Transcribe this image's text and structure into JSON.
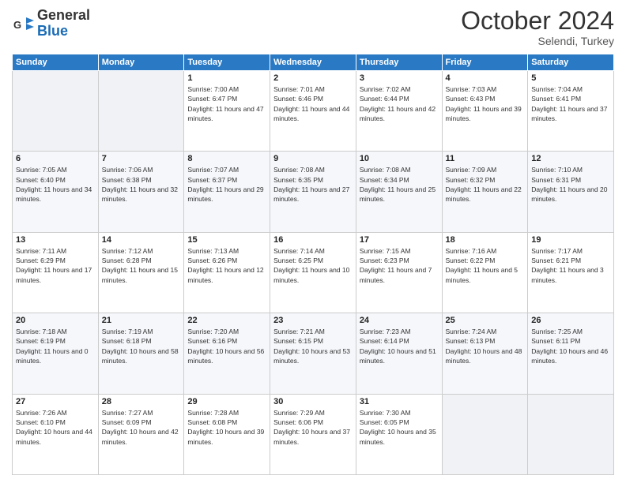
{
  "header": {
    "logo_line1": "General",
    "logo_line2": "Blue",
    "month_title": "October 2024",
    "subtitle": "Selendi, Turkey"
  },
  "weekdays": [
    "Sunday",
    "Monday",
    "Tuesday",
    "Wednesday",
    "Thursday",
    "Friday",
    "Saturday"
  ],
  "weeks": [
    [
      {
        "day": "",
        "info": ""
      },
      {
        "day": "",
        "info": ""
      },
      {
        "day": "1",
        "info": "Sunrise: 7:00 AM\nSunset: 6:47 PM\nDaylight: 11 hours and 47 minutes."
      },
      {
        "day": "2",
        "info": "Sunrise: 7:01 AM\nSunset: 6:46 PM\nDaylight: 11 hours and 44 minutes."
      },
      {
        "day": "3",
        "info": "Sunrise: 7:02 AM\nSunset: 6:44 PM\nDaylight: 11 hours and 42 minutes."
      },
      {
        "day": "4",
        "info": "Sunrise: 7:03 AM\nSunset: 6:43 PM\nDaylight: 11 hours and 39 minutes."
      },
      {
        "day": "5",
        "info": "Sunrise: 7:04 AM\nSunset: 6:41 PM\nDaylight: 11 hours and 37 minutes."
      }
    ],
    [
      {
        "day": "6",
        "info": "Sunrise: 7:05 AM\nSunset: 6:40 PM\nDaylight: 11 hours and 34 minutes."
      },
      {
        "day": "7",
        "info": "Sunrise: 7:06 AM\nSunset: 6:38 PM\nDaylight: 11 hours and 32 minutes."
      },
      {
        "day": "8",
        "info": "Sunrise: 7:07 AM\nSunset: 6:37 PM\nDaylight: 11 hours and 29 minutes."
      },
      {
        "day": "9",
        "info": "Sunrise: 7:08 AM\nSunset: 6:35 PM\nDaylight: 11 hours and 27 minutes."
      },
      {
        "day": "10",
        "info": "Sunrise: 7:08 AM\nSunset: 6:34 PM\nDaylight: 11 hours and 25 minutes."
      },
      {
        "day": "11",
        "info": "Sunrise: 7:09 AM\nSunset: 6:32 PM\nDaylight: 11 hours and 22 minutes."
      },
      {
        "day": "12",
        "info": "Sunrise: 7:10 AM\nSunset: 6:31 PM\nDaylight: 11 hours and 20 minutes."
      }
    ],
    [
      {
        "day": "13",
        "info": "Sunrise: 7:11 AM\nSunset: 6:29 PM\nDaylight: 11 hours and 17 minutes."
      },
      {
        "day": "14",
        "info": "Sunrise: 7:12 AM\nSunset: 6:28 PM\nDaylight: 11 hours and 15 minutes."
      },
      {
        "day": "15",
        "info": "Sunrise: 7:13 AM\nSunset: 6:26 PM\nDaylight: 11 hours and 12 minutes."
      },
      {
        "day": "16",
        "info": "Sunrise: 7:14 AM\nSunset: 6:25 PM\nDaylight: 11 hours and 10 minutes."
      },
      {
        "day": "17",
        "info": "Sunrise: 7:15 AM\nSunset: 6:23 PM\nDaylight: 11 hours and 7 minutes."
      },
      {
        "day": "18",
        "info": "Sunrise: 7:16 AM\nSunset: 6:22 PM\nDaylight: 11 hours and 5 minutes."
      },
      {
        "day": "19",
        "info": "Sunrise: 7:17 AM\nSunset: 6:21 PM\nDaylight: 11 hours and 3 minutes."
      }
    ],
    [
      {
        "day": "20",
        "info": "Sunrise: 7:18 AM\nSunset: 6:19 PM\nDaylight: 11 hours and 0 minutes."
      },
      {
        "day": "21",
        "info": "Sunrise: 7:19 AM\nSunset: 6:18 PM\nDaylight: 10 hours and 58 minutes."
      },
      {
        "day": "22",
        "info": "Sunrise: 7:20 AM\nSunset: 6:16 PM\nDaylight: 10 hours and 56 minutes."
      },
      {
        "day": "23",
        "info": "Sunrise: 7:21 AM\nSunset: 6:15 PM\nDaylight: 10 hours and 53 minutes."
      },
      {
        "day": "24",
        "info": "Sunrise: 7:23 AM\nSunset: 6:14 PM\nDaylight: 10 hours and 51 minutes."
      },
      {
        "day": "25",
        "info": "Sunrise: 7:24 AM\nSunset: 6:13 PM\nDaylight: 10 hours and 48 minutes."
      },
      {
        "day": "26",
        "info": "Sunrise: 7:25 AM\nSunset: 6:11 PM\nDaylight: 10 hours and 46 minutes."
      }
    ],
    [
      {
        "day": "27",
        "info": "Sunrise: 7:26 AM\nSunset: 6:10 PM\nDaylight: 10 hours and 44 minutes."
      },
      {
        "day": "28",
        "info": "Sunrise: 7:27 AM\nSunset: 6:09 PM\nDaylight: 10 hours and 42 minutes."
      },
      {
        "day": "29",
        "info": "Sunrise: 7:28 AM\nSunset: 6:08 PM\nDaylight: 10 hours and 39 minutes."
      },
      {
        "day": "30",
        "info": "Sunrise: 7:29 AM\nSunset: 6:06 PM\nDaylight: 10 hours and 37 minutes."
      },
      {
        "day": "31",
        "info": "Sunrise: 7:30 AM\nSunset: 6:05 PM\nDaylight: 10 hours and 35 minutes."
      },
      {
        "day": "",
        "info": ""
      },
      {
        "day": "",
        "info": ""
      }
    ]
  ]
}
